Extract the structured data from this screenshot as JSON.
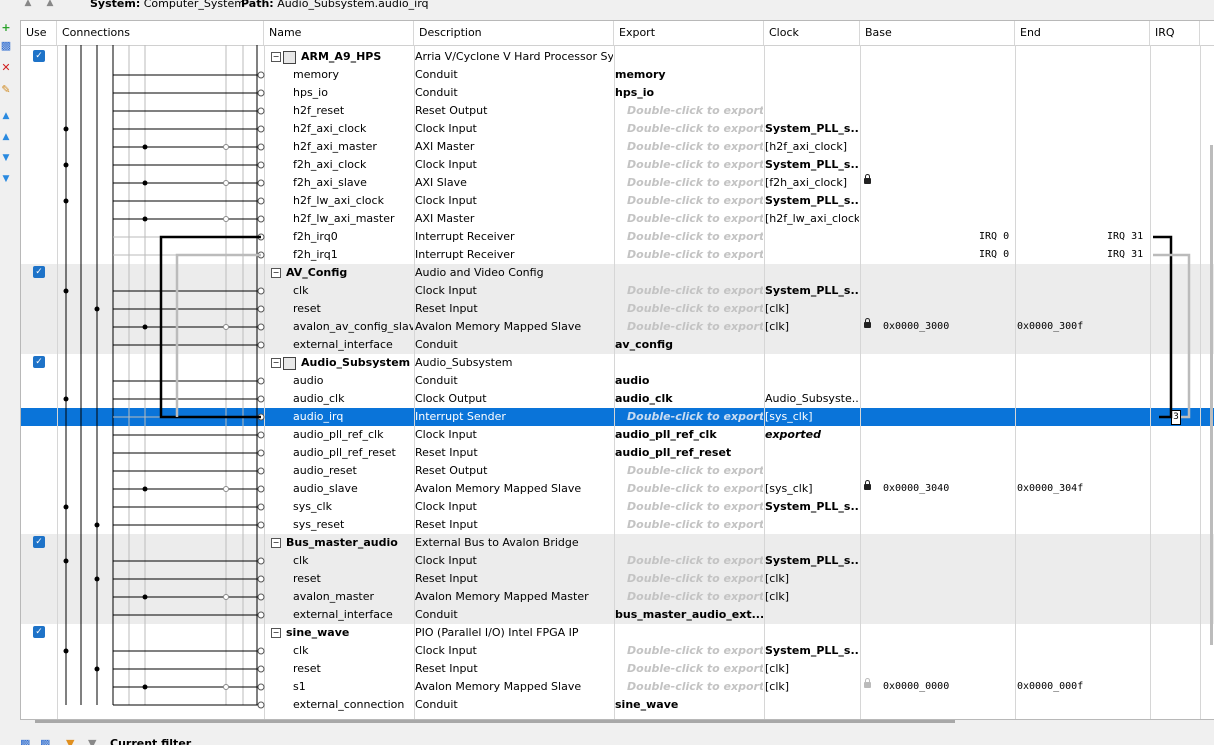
{
  "topbar": {
    "system_label": "System:",
    "system_value": "Computer_System",
    "path_label": "Path:",
    "path_value": "Audio_Subsystem.audio_irq"
  },
  "toolbar": {
    "icons": [
      "add-icon",
      "connect-icon",
      "remove-icon",
      "edit-icon",
      "move-top-icon",
      "move-up-icon",
      "move-down-icon",
      "move-bottom-icon"
    ]
  },
  "columns": {
    "use": "Use",
    "connections": "Connections",
    "name": "Name",
    "description": "Description",
    "export": "Export",
    "clock": "Clock",
    "base": "Base",
    "end": "End",
    "irq": "IRQ"
  },
  "export_placeholder": "Double-click to export",
  "rows": [
    {
      "type": "group",
      "name": "ARM_A9_HPS",
      "desc": "Arria V/Cyclone V Hard Processor System",
      "alt": false,
      "icon": true
    },
    {
      "name": "memory",
      "desc": "Conduit",
      "export": "memory",
      "alt": false
    },
    {
      "name": "hps_io",
      "desc": "Conduit",
      "export": "hps_io",
      "alt": false
    },
    {
      "name": "h2f_reset",
      "desc": "Reset Output",
      "ph": true,
      "alt": false
    },
    {
      "name": "h2f_axi_clock",
      "desc": "Clock Input",
      "ph": true,
      "clock": "System_PLL_s...",
      "clockbold": true,
      "alt": false
    },
    {
      "name": "h2f_axi_master",
      "desc": "AXI Master",
      "ph": true,
      "clock": "[h2f_axi_clock]",
      "alt": false
    },
    {
      "name": "f2h_axi_clock",
      "desc": "Clock Input",
      "ph": true,
      "clock": "System_PLL_s...",
      "clockbold": true,
      "alt": false
    },
    {
      "name": "f2h_axi_slave",
      "desc": "AXI Slave",
      "ph": true,
      "clock": "[f2h_axi_clock]",
      "lock": "closed",
      "alt": false
    },
    {
      "name": "h2f_lw_axi_clock",
      "desc": "Clock Input",
      "ph": true,
      "clock": "System_PLL_s...",
      "clockbold": true,
      "alt": false
    },
    {
      "name": "h2f_lw_axi_master",
      "desc": "AXI Master",
      "ph": true,
      "clock": "[h2f_lw_axi_clock]",
      "alt": false
    },
    {
      "name": "f2h_irq0",
      "desc": "Interrupt Receiver",
      "ph": true,
      "irq_from": "IRQ 0",
      "irq_to": "IRQ 31",
      "alt": false
    },
    {
      "name": "f2h_irq1",
      "desc": "Interrupt Receiver",
      "ph": true,
      "irq_from": "IRQ 0",
      "irq_to": "IRQ 31",
      "alt": false
    },
    {
      "type": "group",
      "name": "AV_Config",
      "desc": "Audio and Video Config",
      "alt": true,
      "icon": false
    },
    {
      "name": "clk",
      "desc": "Clock Input",
      "ph": true,
      "clock": "System_PLL_s...",
      "clockbold": true,
      "alt": true
    },
    {
      "name": "reset",
      "desc": "Reset Input",
      "ph": true,
      "clock": "[clk]",
      "alt": true
    },
    {
      "name": "avalon_av_config_slave",
      "desc": "Avalon Memory Mapped Slave",
      "ph": true,
      "clock": "[clk]",
      "lock": "closed",
      "base": "0x0000_3000",
      "end": "0x0000_300f",
      "alt": true
    },
    {
      "name": "external_interface",
      "desc": "Conduit",
      "export": "av_config",
      "alt": true
    },
    {
      "type": "group",
      "name": "Audio_Subsystem",
      "desc": "Audio_Subsystem",
      "alt": false,
      "icon": true
    },
    {
      "name": "audio",
      "desc": "Conduit",
      "export": "audio",
      "alt": false
    },
    {
      "name": "audio_clk",
      "desc": "Clock Output",
      "export": "audio_clk",
      "clock": "Audio_Subsyste...",
      "alt": false
    },
    {
      "name": "audio_irq",
      "desc": "Interrupt Sender",
      "ph": true,
      "clock": "[sys_clk]",
      "sel": true,
      "irq_num": "3"
    },
    {
      "name": "audio_pll_ref_clk",
      "desc": "Clock Input",
      "export": "audio_pll_ref_clk",
      "clock": "exported",
      "clockitalic": true,
      "alt": false
    },
    {
      "name": "audio_pll_ref_reset",
      "desc": "Reset Input",
      "export": "audio_pll_ref_reset",
      "alt": false
    },
    {
      "name": "audio_reset",
      "desc": "Reset Output",
      "ph": true,
      "alt": false
    },
    {
      "name": "audio_slave",
      "desc": "Avalon Memory Mapped Slave",
      "ph": true,
      "clock": "[sys_clk]",
      "lock": "closed",
      "base": "0x0000_3040",
      "end": "0x0000_304f",
      "alt": false
    },
    {
      "name": "sys_clk",
      "desc": "Clock Input",
      "ph": true,
      "clock": "System_PLL_s...",
      "clockbold": true,
      "alt": false
    },
    {
      "name": "sys_reset",
      "desc": "Reset Input",
      "ph": true,
      "alt": false
    },
    {
      "type": "group",
      "name": "Bus_master_audio",
      "desc": "External Bus to Avalon Bridge",
      "alt": true,
      "icon": false
    },
    {
      "name": "clk",
      "desc": "Clock Input",
      "ph": true,
      "clock": "System_PLL_s...",
      "clockbold": true,
      "alt": true
    },
    {
      "name": "reset",
      "desc": "Reset Input",
      "ph": true,
      "clock": "[clk]",
      "alt": true
    },
    {
      "name": "avalon_master",
      "desc": "Avalon Memory Mapped Master",
      "ph": true,
      "clock": "[clk]",
      "alt": true
    },
    {
      "name": "external_interface",
      "desc": "Conduit",
      "export": "bus_master_audio_ext...",
      "alt": true
    },
    {
      "type": "group",
      "name": "sine_wave",
      "desc": "PIO (Parallel I/O) Intel FPGA IP",
      "alt": false,
      "icon": false
    },
    {
      "name": "clk",
      "desc": "Clock Input",
      "ph": true,
      "clock": "System_PLL_s...",
      "clockbold": true,
      "alt": false
    },
    {
      "name": "reset",
      "desc": "Reset Input",
      "ph": true,
      "clock": "[clk]",
      "alt": false
    },
    {
      "name": "s1",
      "desc": "Avalon Memory Mapped Slave",
      "ph": true,
      "clock": "[clk]",
      "lock": "open",
      "base": "0x0000_0000",
      "end": "0x0000_000f",
      "alt": false
    },
    {
      "name": "external_connection",
      "desc": "Conduit",
      "export": "sine_wave",
      "alt": false
    }
  ],
  "bottom": {
    "filter_label": "Current filter"
  }
}
